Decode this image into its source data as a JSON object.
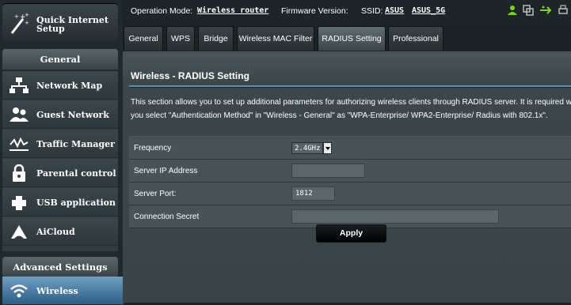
{
  "sidebar": {
    "quick_setup_label": "Quick Internet Setup",
    "general_header": "General",
    "items": [
      {
        "label": "Network Map",
        "icon": "network-map-icon"
      },
      {
        "label": "Guest Network",
        "icon": "guest-network-icon"
      },
      {
        "label": "Traffic Manager",
        "icon": "traffic-manager-icon"
      },
      {
        "label": "Parental control",
        "icon": "parental-control-icon"
      },
      {
        "label": "USB application",
        "icon": "usb-application-icon"
      },
      {
        "label": "AiCloud",
        "icon": "aicloud-icon"
      }
    ],
    "advanced_header": "Advanced Settings",
    "advanced_items": [
      {
        "label": "Wireless",
        "icon": "wireless-icon",
        "active": true
      }
    ]
  },
  "topbar": {
    "operation_mode_label": "Operation Mode:",
    "operation_mode_value": "Wireless router",
    "firmware_label": "Firmware Version:",
    "ssid_label": "SSID:",
    "ssid_1": "ASUS",
    "ssid_2": "ASUS_5G",
    "status_icons": [
      "user-icon",
      "copy-icon",
      "usb-icon",
      "printer-icon"
    ]
  },
  "tabs": [
    {
      "label": "General",
      "active": false
    },
    {
      "label": "WPS",
      "active": false
    },
    {
      "label": "Bridge",
      "active": false
    },
    {
      "label": "Wireless MAC Filter",
      "active": false
    },
    {
      "label": "RADIUS Setting",
      "active": true
    },
    {
      "label": "Professional",
      "active": false
    }
  ],
  "panel": {
    "title": "Wireless - RADIUS Setting",
    "description_lines": [
      "This section allows you to set up additional parameters for authorizing wireless clients through RADIUS server. It is required while",
      "you select \"Authentication Method\" in \"Wireless - General\" as \"WPA-Enterprise/ WPA2-Enterprise/ Radius with 802.1x\"."
    ],
    "fields": {
      "frequency_label": "Frequency",
      "frequency_value": "2.4GHz",
      "server_ip_label": "Server IP Address",
      "server_ip_value": "",
      "server_port_label": "Server Port:",
      "server_port_value": "1812",
      "secret_label": "Connection Secret",
      "secret_value": ""
    },
    "apply_label": "Apply"
  },
  "colors": {
    "accent_blue": "#5b8fb4",
    "active_menu": "#2f6088",
    "status_green": "#7ed321"
  }
}
